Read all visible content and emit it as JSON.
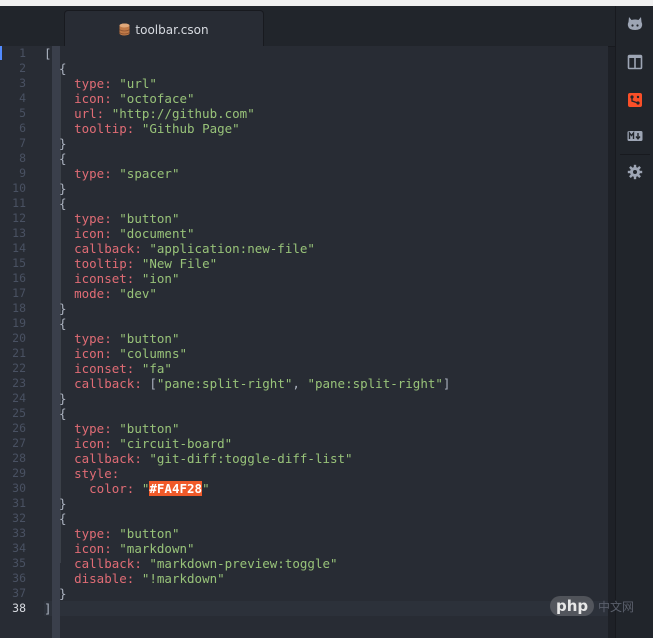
{
  "tab": {
    "title": "toolbar.cson",
    "icon": "database-icon"
  },
  "gutter": {
    "line_numbers": [
      "1",
      "2",
      "3",
      "4",
      "5",
      "6",
      "7",
      "8",
      "9",
      "10",
      "11",
      "12",
      "13",
      "14",
      "15",
      "16",
      "17",
      "18",
      "19",
      "20",
      "21",
      "22",
      "23",
      "24",
      "25",
      "26",
      "27",
      "28",
      "29",
      "30",
      "31",
      "32",
      "33",
      "34",
      "35",
      "36",
      "37",
      "38"
    ],
    "active_line": "38"
  },
  "code_lines": [
    [
      {
        "t": "[",
        "c": "p"
      }
    ],
    [
      {
        "t": "  {",
        "c": "p"
      }
    ],
    [
      {
        "t": "    ",
        "c": "p"
      },
      {
        "t": "type:",
        "c": "k"
      },
      {
        "t": " ",
        "c": "p"
      },
      {
        "t": "\"url\"",
        "c": "s"
      }
    ],
    [
      {
        "t": "    ",
        "c": "p"
      },
      {
        "t": "icon:",
        "c": "k"
      },
      {
        "t": " ",
        "c": "p"
      },
      {
        "t": "\"octoface\"",
        "c": "s"
      }
    ],
    [
      {
        "t": "    ",
        "c": "p"
      },
      {
        "t": "url:",
        "c": "k"
      },
      {
        "t": " ",
        "c": "p"
      },
      {
        "t": "\"http://github.com\"",
        "c": "s"
      }
    ],
    [
      {
        "t": "    ",
        "c": "p"
      },
      {
        "t": "tooltip:",
        "c": "k"
      },
      {
        "t": " ",
        "c": "p"
      },
      {
        "t": "\"Github Page\"",
        "c": "s"
      }
    ],
    [
      {
        "t": "  }",
        "c": "p"
      }
    ],
    [
      {
        "t": "  {",
        "c": "p"
      }
    ],
    [
      {
        "t": "    ",
        "c": "p"
      },
      {
        "t": "type:",
        "c": "k"
      },
      {
        "t": " ",
        "c": "p"
      },
      {
        "t": "\"spacer\"",
        "c": "s"
      }
    ],
    [
      {
        "t": "  }",
        "c": "p"
      }
    ],
    [
      {
        "t": "  {",
        "c": "p"
      }
    ],
    [
      {
        "t": "    ",
        "c": "p"
      },
      {
        "t": "type:",
        "c": "k"
      },
      {
        "t": " ",
        "c": "p"
      },
      {
        "t": "\"button\"",
        "c": "s"
      }
    ],
    [
      {
        "t": "    ",
        "c": "p"
      },
      {
        "t": "icon:",
        "c": "k"
      },
      {
        "t": " ",
        "c": "p"
      },
      {
        "t": "\"document\"",
        "c": "s"
      }
    ],
    [
      {
        "t": "    ",
        "c": "p"
      },
      {
        "t": "callback:",
        "c": "k"
      },
      {
        "t": " ",
        "c": "p"
      },
      {
        "t": "\"application:new-file\"",
        "c": "s"
      }
    ],
    [
      {
        "t": "    ",
        "c": "p"
      },
      {
        "t": "tooltip:",
        "c": "k"
      },
      {
        "t": " ",
        "c": "p"
      },
      {
        "t": "\"New File\"",
        "c": "s"
      }
    ],
    [
      {
        "t": "    ",
        "c": "p"
      },
      {
        "t": "iconset:",
        "c": "k"
      },
      {
        "t": " ",
        "c": "p"
      },
      {
        "t": "\"ion\"",
        "c": "s"
      }
    ],
    [
      {
        "t": "    ",
        "c": "p"
      },
      {
        "t": "mode:",
        "c": "k"
      },
      {
        "t": " ",
        "c": "p"
      },
      {
        "t": "\"dev\"",
        "c": "s"
      }
    ],
    [
      {
        "t": "  }",
        "c": "p"
      }
    ],
    [
      {
        "t": "  {",
        "c": "p"
      }
    ],
    [
      {
        "t": "    ",
        "c": "p"
      },
      {
        "t": "type:",
        "c": "k"
      },
      {
        "t": " ",
        "c": "p"
      },
      {
        "t": "\"button\"",
        "c": "s"
      }
    ],
    [
      {
        "t": "    ",
        "c": "p"
      },
      {
        "t": "icon:",
        "c": "k"
      },
      {
        "t": " ",
        "c": "p"
      },
      {
        "t": "\"columns\"",
        "c": "s"
      }
    ],
    [
      {
        "t": "    ",
        "c": "p"
      },
      {
        "t": "iconset:",
        "c": "k"
      },
      {
        "t": " ",
        "c": "p"
      },
      {
        "t": "\"fa\"",
        "c": "s"
      }
    ],
    [
      {
        "t": "    ",
        "c": "p"
      },
      {
        "t": "callback:",
        "c": "k"
      },
      {
        "t": " [",
        "c": "p"
      },
      {
        "t": "\"pane:split-right\"",
        "c": "s"
      },
      {
        "t": ", ",
        "c": "p"
      },
      {
        "t": "\"pane:split-right\"",
        "c": "s"
      },
      {
        "t": "]",
        "c": "p"
      }
    ],
    [
      {
        "t": "  }",
        "c": "p"
      }
    ],
    [
      {
        "t": "  {",
        "c": "p"
      }
    ],
    [
      {
        "t": "    ",
        "c": "p"
      },
      {
        "t": "type:",
        "c": "k"
      },
      {
        "t": " ",
        "c": "p"
      },
      {
        "t": "\"button\"",
        "c": "s"
      }
    ],
    [
      {
        "t": "    ",
        "c": "p"
      },
      {
        "t": "icon:",
        "c": "k"
      },
      {
        "t": " ",
        "c": "p"
      },
      {
        "t": "\"circuit-board\"",
        "c": "s"
      }
    ],
    [
      {
        "t": "    ",
        "c": "p"
      },
      {
        "t": "callback:",
        "c": "k"
      },
      {
        "t": " ",
        "c": "p"
      },
      {
        "t": "\"git-diff:toggle-diff-list\"",
        "c": "s"
      }
    ],
    [
      {
        "t": "    ",
        "c": "p"
      },
      {
        "t": "style:",
        "c": "k"
      }
    ],
    [
      {
        "t": "      ",
        "c": "p"
      },
      {
        "t": "color:",
        "c": "k"
      },
      {
        "t": " ",
        "c": "p"
      },
      {
        "t": "\"",
        "c": "s"
      },
      {
        "t": "#FA4F28",
        "c": "hl"
      },
      {
        "t": "\"",
        "c": "s"
      }
    ],
    [
      {
        "t": "  }",
        "c": "p"
      }
    ],
    [
      {
        "t": "  {",
        "c": "p"
      }
    ],
    [
      {
        "t": "    ",
        "c": "p"
      },
      {
        "t": "type:",
        "c": "k"
      },
      {
        "t": " ",
        "c": "p"
      },
      {
        "t": "\"button\"",
        "c": "s"
      }
    ],
    [
      {
        "t": "    ",
        "c": "p"
      },
      {
        "t": "icon:",
        "c": "k"
      },
      {
        "t": " ",
        "c": "p"
      },
      {
        "t": "\"markdown\"",
        "c": "s"
      }
    ],
    [
      {
        "t": "    ",
        "c": "p"
      },
      {
        "t": "callback:",
        "c": "k"
      },
      {
        "t": " ",
        "c": "p"
      },
      {
        "t": "\"markdown-preview:toggle\"",
        "c": "s"
      }
    ],
    [
      {
        "t": "    ",
        "c": "p"
      },
      {
        "t": "disable:",
        "c": "k"
      },
      {
        "t": " ",
        "c": "p"
      },
      {
        "t": "\"!markdown\"",
        "c": "s"
      }
    ],
    [
      {
        "t": "  }",
        "c": "p"
      }
    ],
    [
      {
        "t": "]",
        "c": "p"
      }
    ]
  ],
  "toolbar": {
    "buttons": [
      {
        "name": "octoface-icon"
      },
      {
        "name": "columns-icon"
      },
      {
        "name": "circuit-board-icon",
        "color": "#FA4F28"
      },
      {
        "name": "markdown-icon"
      },
      {
        "name": "gear-icon"
      }
    ]
  },
  "watermark": {
    "text": "php",
    "subtext": "中文网"
  },
  "colors": {
    "keyword": "#e06c75",
    "string": "#98c379",
    "highlight": "#f05a2a",
    "accent": "#528bff"
  }
}
